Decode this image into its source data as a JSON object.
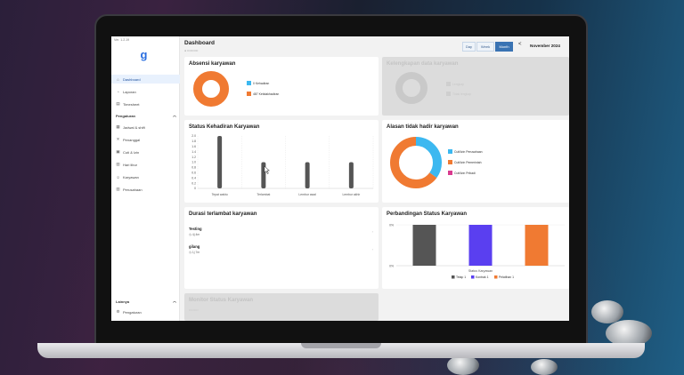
{
  "app": {
    "version": "Ver. 1.2.19",
    "logo": "g"
  },
  "sidebar": {
    "items": [
      {
        "label": "Dashboard",
        "icon": "home-icon",
        "active": true
      },
      {
        "label": "Laporan",
        "icon": "report-icon"
      },
      {
        "label": "Timesheet",
        "icon": "timesheet-icon"
      }
    ],
    "group_label": "Pengaturan",
    "group_items": [
      {
        "label": "Jadwal & shift",
        "icon": "calendar-icon"
      },
      {
        "label": "Penanggal",
        "icon": "tool-icon"
      },
      {
        "label": "Cuti & Izin",
        "icon": "leave-icon"
      },
      {
        "label": "Hari libur",
        "icon": "holiday-icon"
      },
      {
        "label": "Karyawan",
        "icon": "users-icon"
      },
      {
        "label": "Perusahaan",
        "icon": "building-icon"
      }
    ],
    "other_label": "Lainnya",
    "other_items": [
      {
        "label": "Pengaturan",
        "icon": "gear-icon"
      }
    ]
  },
  "header": {
    "title": "Dashboard",
    "subtitle": "● ••••••••••",
    "ranges": [
      "Day",
      "Week",
      "Month"
    ],
    "active_range": "Month",
    "prev_symbol": "<",
    "month": "November 2024"
  },
  "cards": {
    "absensi": {
      "title": "Absensi karyawan",
      "legend": [
        "0 Kehadiran",
        "487 Ketidakhadiran"
      ]
    },
    "kelengkapan": {
      "title": "Kelengkapan data karyawan",
      "legend": [
        "Lengkap",
        "Tidak lengkap"
      ]
    },
    "status": {
      "title": "Status Kehadiran Karyawan"
    },
    "alasan": {
      "title": "Alasan tidak hadir karyawan",
      "legend": [
        "Cuti/Izin Perusahaan",
        "Cuti/Izin Pemerintah",
        "Cuti/Izin Pribadi"
      ]
    },
    "durasi": {
      "title": "Durasi terlambat karyawan",
      "items": [
        {
          "name": "Testing",
          "time": "4j 4m"
        },
        {
          "name": "gilang",
          "time": "1j 7m"
        }
      ]
    },
    "perbandingan": {
      "title": "Perbandingan Status Karyawan"
    },
    "monitor": {
      "title": "Monitor Status Karyawan",
      "sub": "•••••••••"
    }
  },
  "colors": {
    "accent": "#3a73b3",
    "orange": "#f07a32",
    "cyan": "#3cb8f0",
    "magenta": "#d93b8f",
    "dark": "#555555",
    "purple": "#5a3ff0"
  },
  "chart_data": [
    {
      "type": "pie",
      "title": "Absensi karyawan",
      "labels": [
        "0 Kehadiran",
        "487 Ketidakhadiran"
      ],
      "values": [
        0,
        487
      ],
      "colors": [
        "#3cb8f0",
        "#f07a32"
      ]
    },
    {
      "type": "bar",
      "title": "Status Kehadiran Karyawan",
      "categories": [
        "Tepat waktu",
        "Terlambat",
        "Lembur awal",
        "Lembur akhir"
      ],
      "values": [
        2.0,
        1.0,
        1.0,
        1.0
      ],
      "ylim": [
        0,
        2.0
      ],
      "yticks": [
        "0",
        "0.2",
        "0.4",
        "0.6",
        "0.8",
        "1.0",
        "1.2",
        "1.4",
        "1.6",
        "1.8",
        "2.0"
      ],
      "color": "#555555"
    },
    {
      "type": "pie",
      "title": "Alasan tidak hadir karyawan",
      "labels": [
        "Cuti/Izin Perusahaan",
        "Cuti/Izin Pemerintah",
        "Cuti/Izin Pribadi"
      ],
      "values": [
        35,
        65,
        0
      ],
      "colors": [
        "#3cb8f0",
        "#f07a32",
        "#d93b8f"
      ]
    },
    {
      "type": "bar",
      "title": "Perbandingan Status Karyawan",
      "categories": [
        "Tetap",
        "Kontrak",
        "Pelatihan"
      ],
      "values": [
        1,
        1,
        1
      ],
      "series_legend": [
        "Tetap 1",
        "Kontrak 1",
        "Pelatihan 1"
      ],
      "colors": [
        "#555555",
        "#5a3ff0",
        "#f07a32"
      ],
      "xlabel": "Status Karyawan",
      "yticks": [
        "0%",
        "0%"
      ]
    }
  ]
}
